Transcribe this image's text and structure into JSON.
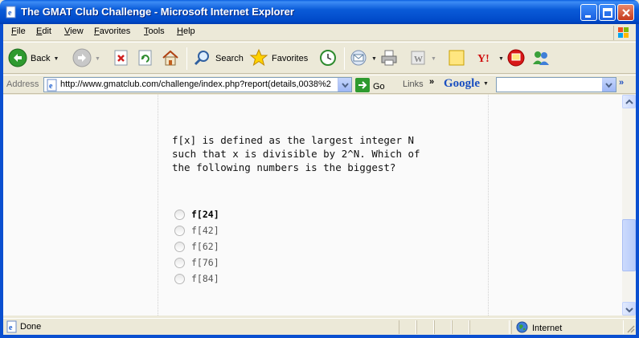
{
  "window": {
    "title": "The GMAT Club Challenge - Microsoft Internet Explorer"
  },
  "menu": [
    "File",
    "Edit",
    "View",
    "Favorites",
    "Tools",
    "Help"
  ],
  "toolbar": {
    "back_label": "Back",
    "search_label": "Search",
    "favorites_label": "Favorites"
  },
  "address": {
    "label": "Address",
    "url": "http://www.gmatclub.com/challenge/index.php?report(details,0038%2",
    "go_label": "Go",
    "links_label": "Links",
    "google_label": "Google"
  },
  "question": {
    "text": "f[x] is defined as the largest integer N\nsuch that x is divisible by 2^N. Which of\nthe following numbers is the biggest?",
    "options": [
      {
        "label": "f[24]",
        "emphasized": true
      },
      {
        "label": "f[42]",
        "emphasized": false
      },
      {
        "label": "f[62]",
        "emphasized": false
      },
      {
        "label": "f[76]",
        "emphasized": false
      },
      {
        "label": "f[84]",
        "emphasized": false
      }
    ]
  },
  "status": {
    "text": "Done",
    "zone": "Internet"
  }
}
